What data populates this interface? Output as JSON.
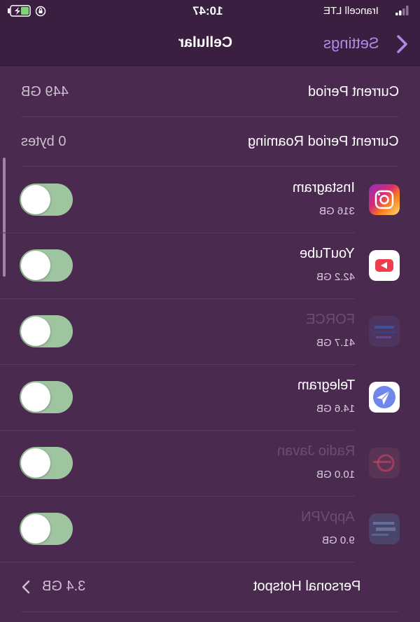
{
  "status_bar": {
    "time": "10:47",
    "carrier": "Irancell  LTE"
  },
  "nav": {
    "title": "Cellular",
    "back_label": "Settings"
  },
  "summary": [
    {
      "label": "Current Period",
      "value": "449 GB"
    },
    {
      "label": "Current Period Roaming",
      "value": "0 bytes"
    }
  ],
  "apps": [
    {
      "name": "Instagram",
      "usage": "316 GB",
      "icon": "instagram-icon",
      "enabled": true,
      "faded": false
    },
    {
      "name": "YouTube",
      "usage": "42.2 GB",
      "icon": "youtube-icon",
      "enabled": true,
      "faded": false
    },
    {
      "name": "FORCE",
      "usage": "41.7 GB",
      "icon": "force-app-icon",
      "enabled": true,
      "faded": true
    },
    {
      "name": "Telegram",
      "usage": "14.6 GB",
      "icon": "telegram-icon",
      "enabled": true,
      "faded": false
    },
    {
      "name": "Radio Javan",
      "usage": "10.0 GB",
      "icon": "radio-javan-icon",
      "enabled": true,
      "faded": true
    },
    {
      "name": "AppVPN",
      "usage": "9.0 GB",
      "icon": "appvpn-icon",
      "enabled": true,
      "faded": true
    }
  ],
  "hotspot": {
    "label": "Personal Hotspot",
    "value": "3.4 GB"
  },
  "colors": {
    "background": "#4a2a4f",
    "bar": "#3b1f40",
    "accent": "#a98de8",
    "toggle_on": "#9ec59f"
  }
}
